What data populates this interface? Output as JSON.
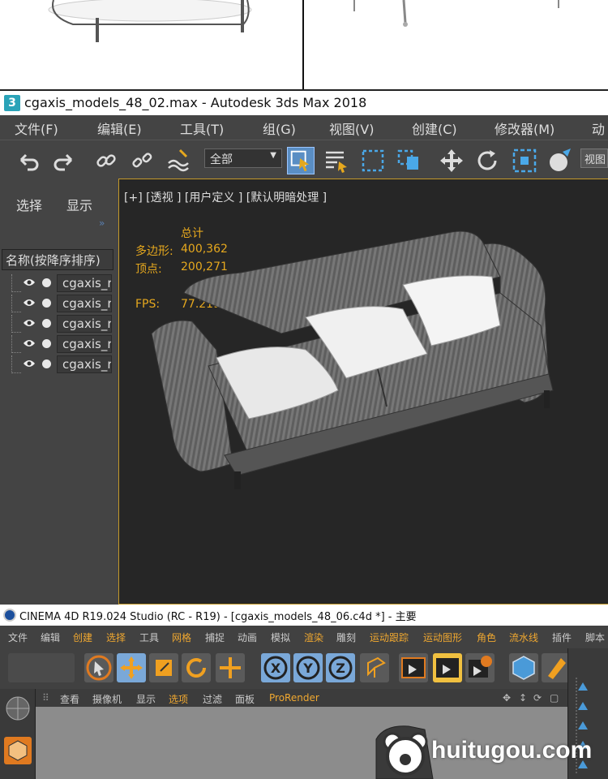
{
  "max": {
    "title": "cgaxis_models_48_02.max - Autodesk 3ds Max 2018",
    "menu": [
      "文件(F)",
      "编辑(E)",
      "工具(T)",
      "组(G)",
      "视图(V)",
      "创建(C)",
      "修改器(M)",
      "动"
    ],
    "toolbar": {
      "selection_filter": "全部",
      "view_label": "视图"
    },
    "scene_explorer": {
      "tabs": [
        "选择",
        "显示"
      ],
      "header": "名称(按降序排序)",
      "items": [
        "cgaxis_r",
        "cgaxis_r",
        "cgaxis_r",
        "cgaxis_r",
        "cgaxis_r"
      ]
    },
    "viewport": {
      "label": "[+] [透视 ] [用户定义 ] [默认明暗处理 ]",
      "stats_header": "总计",
      "poly_label": "多边形:",
      "poly_value": "400,362",
      "vert_label": "顶点:",
      "vert_value": "200,271",
      "fps_label": "FPS:",
      "fps_value": "77.219"
    }
  },
  "c4d": {
    "title": "CINEMA 4D R19.024 Studio (RC - R19) - [cgaxis_models_48_06.c4d *] - 主要",
    "menu": [
      "文件",
      "编辑",
      "创建",
      "选择",
      "工具",
      "网格",
      "捕捉",
      "动画",
      "模拟",
      "渲染",
      "雕刻",
      "运动跟踪",
      "运动图形",
      "角色",
      "流水线",
      "插件",
      "脚本"
    ],
    "axis_buttons": [
      "X",
      "Y",
      "Z"
    ],
    "viewport_menu": [
      "查看",
      "摄像机",
      "显示",
      "选项",
      "过滤",
      "面板",
      "ProRender"
    ]
  },
  "watermark": "huitugou.com",
  "colors": {
    "accent": "#e6a81e",
    "selected": "#5a8ec4",
    "viewport_border": "#c49a2a"
  }
}
